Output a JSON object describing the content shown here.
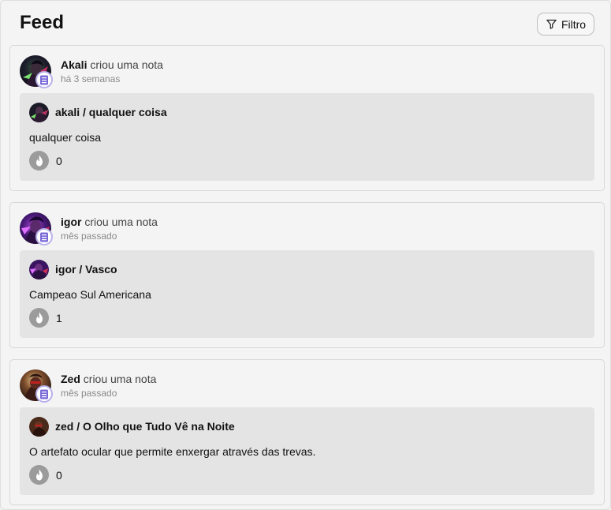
{
  "header": {
    "title": "Feed",
    "filter_label": "Filtro",
    "filter_icon": "filter-icon"
  },
  "colors": {
    "background": "#f4f4f4",
    "inner_panel": "#e4e4e4",
    "badge_accent": "#7a6ad8",
    "reaction_button": "#9b9b9b"
  },
  "feed": [
    {
      "user": "Akali",
      "action": "criou uma nota",
      "time": "há 3 semanas",
      "note_title": "akali / qualquer coisa",
      "note_body": "qualquer coisa",
      "reactions": "0",
      "reaction_icon": "flame-icon",
      "badge_icon": "note-icon"
    },
    {
      "user": "igor",
      "action": "criou uma nota",
      "time": "mês passado",
      "note_title": "igor / Vasco",
      "note_body": "Campeao Sul Americana",
      "reactions": "1",
      "reaction_icon": "flame-icon",
      "badge_icon": "note-icon"
    },
    {
      "user": "Zed",
      "action": "criou uma nota",
      "time": "mês passado",
      "note_title": "zed / O Olho que Tudo Vê na Noite",
      "note_body": "O artefato ocular que permite enxergar através das trevas.",
      "reactions": "0",
      "reaction_icon": "flame-icon",
      "badge_icon": "note-icon"
    }
  ]
}
